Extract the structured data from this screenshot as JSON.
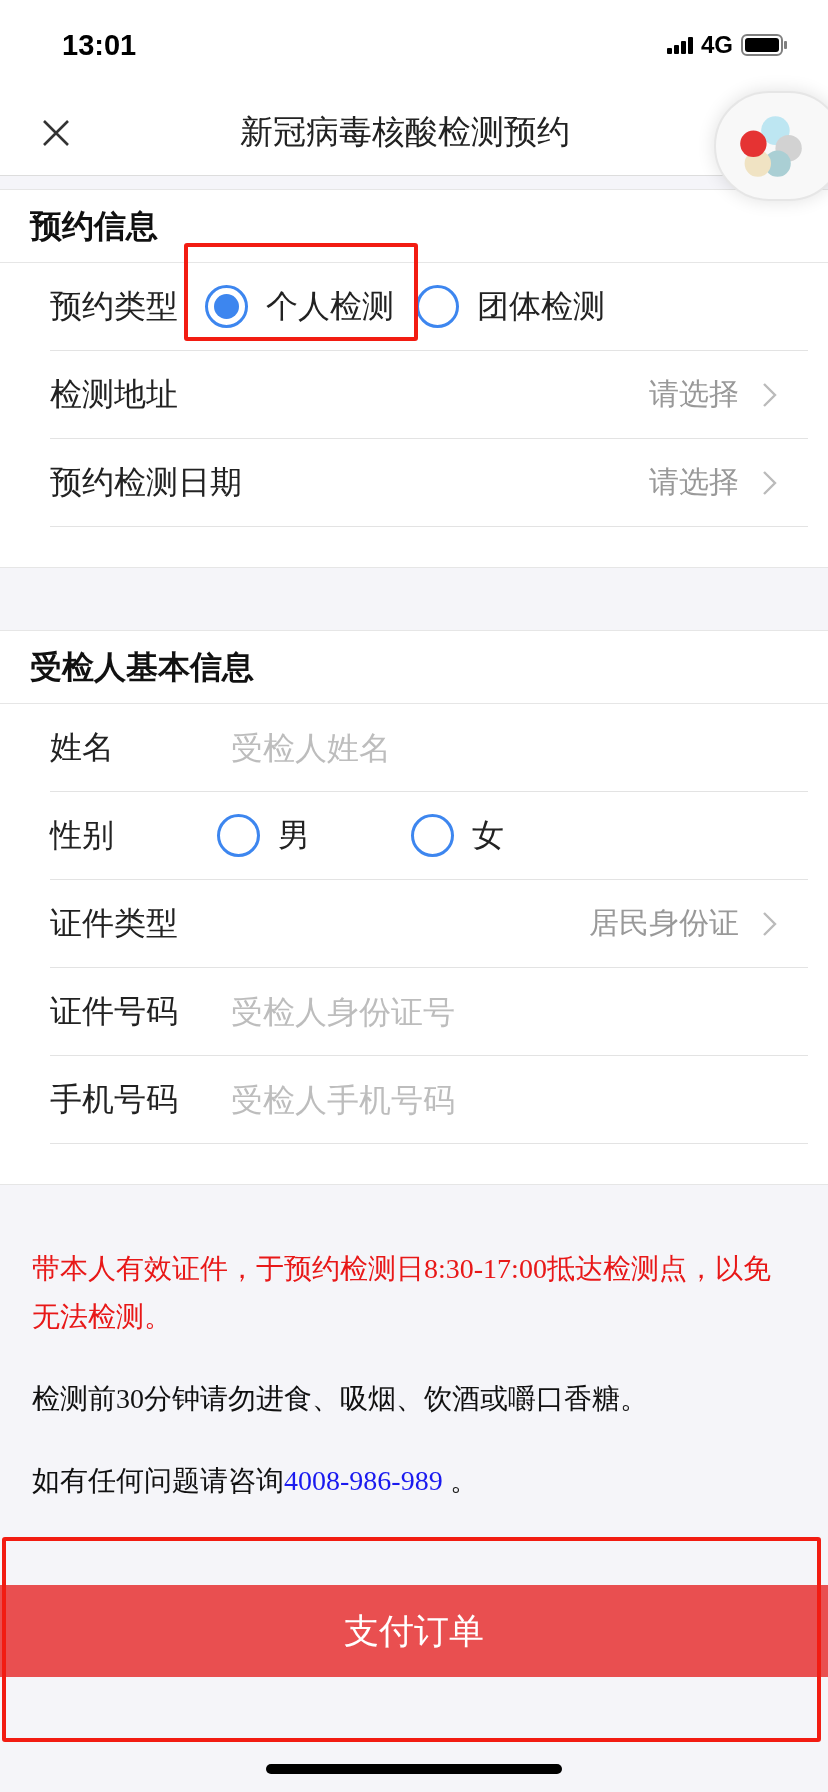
{
  "status_bar": {
    "time": "13:01",
    "network": "4G"
  },
  "nav": {
    "title": "新冠病毒核酸检测预约"
  },
  "sections": [
    {
      "title": "预约信息",
      "rows": [
        {
          "kind": "radio",
          "label": "预约类型",
          "options": [
            {
              "label": "个人检测",
              "selected": true
            },
            {
              "label": "团体检测",
              "selected": false
            }
          ]
        },
        {
          "kind": "select",
          "label": "检测地址",
          "value": "请选择"
        },
        {
          "kind": "select",
          "label": "预约检测日期",
          "value": "请选择"
        }
      ]
    },
    {
      "title": "受检人基本信息",
      "rows": [
        {
          "kind": "input",
          "label": "姓名",
          "placeholder": "受检人姓名"
        },
        {
          "kind": "radio",
          "label": "性别",
          "options": [
            {
              "label": "男",
              "selected": false
            },
            {
              "label": "女",
              "selected": false
            }
          ]
        },
        {
          "kind": "select",
          "label": "证件类型",
          "value": "居民身份证"
        },
        {
          "kind": "input",
          "label": "证件号码",
          "placeholder": "受检人身份证号"
        },
        {
          "kind": "input",
          "label": "手机号码",
          "placeholder": "受检人手机号码"
        }
      ]
    }
  ],
  "notes": [
    {
      "kind": "warning",
      "text": "带本人有效证件，于预约检测日8:30-17:00抵达检测点，以免无法检测。"
    },
    {
      "kind": "plain",
      "text": "检测前30分钟请勿进食、吸烟、饮酒或嚼口香糖。"
    },
    {
      "kind": "contact",
      "text": "如有任何问题请咨询",
      "link": "4008-986-989",
      "suffix": " 。"
    }
  ],
  "pay_button": {
    "label": "支付订单"
  }
}
